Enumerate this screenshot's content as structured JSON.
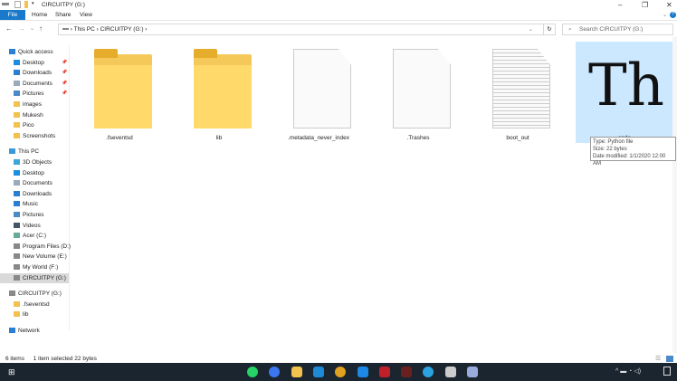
{
  "window": {
    "title": "CIRCUITPY (G:)"
  },
  "ribbon": {
    "tabs": [
      "File",
      "Home",
      "Share",
      "View"
    ]
  },
  "address": {
    "crumbs": [
      "This PC",
      "CIRCUITPY (G:)"
    ],
    "search_placeholder": "Search CIRCUITPY (G:)"
  },
  "sidebar": {
    "items": [
      {
        "label": "Quick access",
        "icon": "star-icon",
        "color": "#2a7fd4",
        "pinned": false,
        "indent": 1
      },
      {
        "label": "Desktop",
        "icon": "desktop-icon",
        "color": "#1b8ee0",
        "pinned": true,
        "indent": 2
      },
      {
        "label": "Downloads",
        "icon": "download-icon",
        "color": "#2a7fd4",
        "pinned": true,
        "indent": 2
      },
      {
        "label": "Documents",
        "icon": "documents-icon",
        "color": "#9ab",
        "pinned": true,
        "indent": 2
      },
      {
        "label": "Pictures",
        "icon": "pictures-icon",
        "color": "#4a8ac8",
        "pinned": true,
        "indent": 2
      },
      {
        "label": "images",
        "icon": "folder-icon",
        "color": "#f2c14e",
        "pinned": false,
        "indent": 2
      },
      {
        "label": "Mukesh",
        "icon": "folder-icon",
        "color": "#f2c14e",
        "pinned": false,
        "indent": 2
      },
      {
        "label": "Pico",
        "icon": "folder-icon",
        "color": "#f2c14e",
        "pinned": false,
        "indent": 2
      },
      {
        "label": "Screenshots",
        "icon": "folder-icon",
        "color": "#f2c14e",
        "pinned": false,
        "indent": 2
      },
      {
        "label": "This PC",
        "icon": "computer-icon",
        "color": "#3a9ad9",
        "pinned": false,
        "indent": 1
      },
      {
        "label": "3D Objects",
        "icon": "cube-icon",
        "color": "#3aa6d9",
        "pinned": false,
        "indent": 2
      },
      {
        "label": "Desktop",
        "icon": "desktop-icon",
        "color": "#1b8ee0",
        "pinned": false,
        "indent": 2
      },
      {
        "label": "Documents",
        "icon": "documents-icon",
        "color": "#9ab",
        "pinned": false,
        "indent": 2
      },
      {
        "label": "Downloads",
        "icon": "download-icon",
        "color": "#2a7fd4",
        "pinned": false,
        "indent": 2
      },
      {
        "label": "Music",
        "icon": "music-icon",
        "color": "#2a7fd4",
        "pinned": false,
        "indent": 2
      },
      {
        "label": "Pictures",
        "icon": "pictures-icon",
        "color": "#4a8ac8",
        "pinned": false,
        "indent": 2
      },
      {
        "label": "Videos",
        "icon": "video-icon",
        "color": "#456",
        "pinned": false,
        "indent": 2
      },
      {
        "label": "Acer (C:)",
        "icon": "drive-icon",
        "color": "#6a9",
        "pinned": false,
        "indent": 2
      },
      {
        "label": "Program Files (D:)",
        "icon": "drive-icon",
        "color": "#888",
        "pinned": false,
        "indent": 2
      },
      {
        "label": "New Volume (E:)",
        "icon": "drive-icon",
        "color": "#888",
        "pinned": false,
        "indent": 2
      },
      {
        "label": "My World (F:)",
        "icon": "drive-icon",
        "color": "#888",
        "pinned": false,
        "indent": 2
      },
      {
        "label": "CIRCUITPY (G:)",
        "icon": "drive-icon",
        "color": "#888",
        "pinned": false,
        "indent": 2,
        "selected": true
      },
      {
        "label": "CIRCUITPY (G:)",
        "icon": "drive-icon",
        "color": "#888",
        "pinned": false,
        "indent": 1
      },
      {
        "label": ".fseventsd",
        "icon": "folder-icon",
        "color": "#f2c14e",
        "pinned": false,
        "indent": 2
      },
      {
        "label": "lib",
        "icon": "folder-icon",
        "color": "#f2c14e",
        "pinned": false,
        "indent": 2
      },
      {
        "label": "Network",
        "icon": "network-icon",
        "color": "#2a7fd4",
        "pinned": false,
        "indent": 1
      }
    ]
  },
  "files": [
    {
      "name": ".fseventsd",
      "type": "folder"
    },
    {
      "name": "lib",
      "type": "folder"
    },
    {
      "name": ".metadata_never_index",
      "type": "file"
    },
    {
      "name": ".Trashes",
      "type": "file"
    },
    {
      "name": "boot_out",
      "type": "text"
    },
    {
      "name": "code",
      "type": "python",
      "selected": true,
      "glyph": "Th"
    }
  ],
  "tooltip": {
    "type": "Type: Python file",
    "size": "Size: 22 bytes",
    "modified": "Date modified: 1/1/2020 12:00 AM"
  },
  "status": {
    "count": "6 items",
    "selection": "1 item selected  22 bytes"
  },
  "taskbar": {
    "apps": [
      {
        "name": "whatsapp",
        "color": "#25d366"
      },
      {
        "name": "signal",
        "color": "#3a76f0"
      },
      {
        "name": "file-explorer",
        "color": "#f2c14e"
      },
      {
        "name": "vscode",
        "color": "#1e8ad6"
      },
      {
        "name": "chrome",
        "color": "#e0a020"
      },
      {
        "name": "app-blue",
        "color": "#1e88e5"
      },
      {
        "name": "app-v",
        "color": "#c0202a"
      },
      {
        "name": "app-dark",
        "color": "#6a2020"
      },
      {
        "name": "telegram",
        "color": "#2aa3e0"
      },
      {
        "name": "thonny",
        "color": "#ccc"
      },
      {
        "name": "notepad",
        "color": "#9ad"
      }
    ]
  }
}
